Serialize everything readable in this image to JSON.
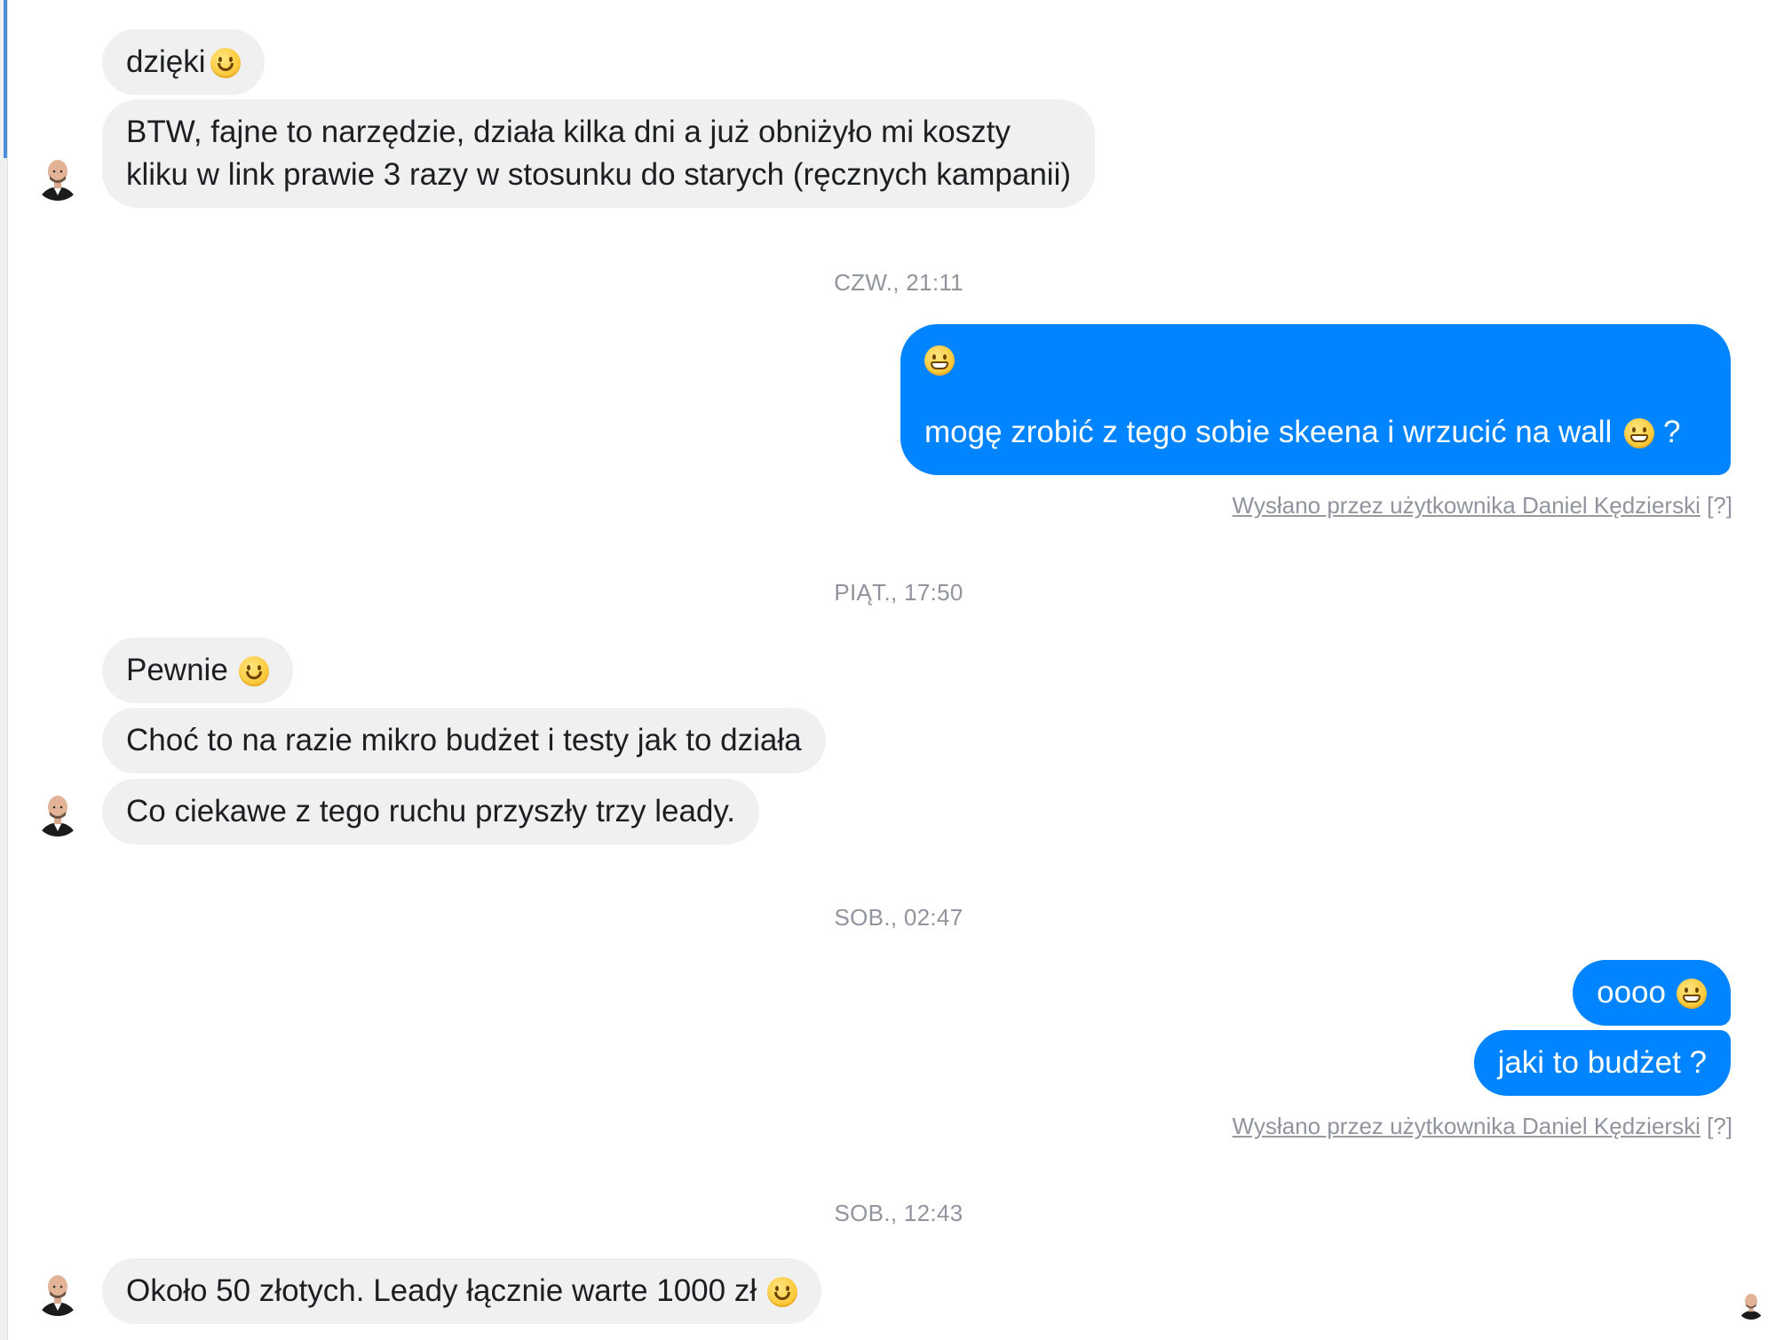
{
  "messages": {
    "m1": {
      "text": "dzięki",
      "emoji": "slightly-smiling-face"
    },
    "m2": {
      "line1": "BTW, fajne to narzędzie, działa kilka dni a już obniżyło mi koszty",
      "line2": "kliku w link prawie 3 razy w stosunku do starych (ręcznych kampanii)"
    },
    "ts1": "CZW., 21:11",
    "m3": {
      "emoji": "grimacing-face",
      "text": "mogę zrobić z tego sobie skeena i wrzucić na wall",
      "suffix": "?"
    },
    "sent_by_1": {
      "text": "Wysłano przez użytkownika Daniel Kędzierski",
      "help": "[?]"
    },
    "ts2": "PIĄT., 17:50",
    "m4": {
      "text": "Pewnie",
      "emoji": "slightly-smiling-face"
    },
    "m5": {
      "text": "Choć to na razie mikro budżet i testy jak to działa"
    },
    "m6": {
      "text": "Co ciekawe z tego ruchu przyszły trzy leady."
    },
    "ts3": "SOB., 02:47",
    "m7": {
      "text": "oooo",
      "emoji": "grimacing-face"
    },
    "m8": {
      "text": "jaki to budżet ?"
    },
    "sent_by_2": {
      "text": "Wysłano przez użytkownika Daniel Kędzierski",
      "help": "[?]"
    },
    "ts4": "SOB., 12:43",
    "m9": {
      "text": "Około 50 złotych. Leady łącznie warte 1000 zł",
      "emoji": "slightly-smiling-face"
    }
  },
  "colors": {
    "incoming_bubble": "#f0f0f0",
    "outgoing_bubble": "#0084ff",
    "timestamp": "#90949c",
    "edge_accent": "#4a90d9"
  },
  "icons": {
    "contact_avatar": "bald-man-avatar",
    "read_receipt": "read-receipt-avatar"
  }
}
